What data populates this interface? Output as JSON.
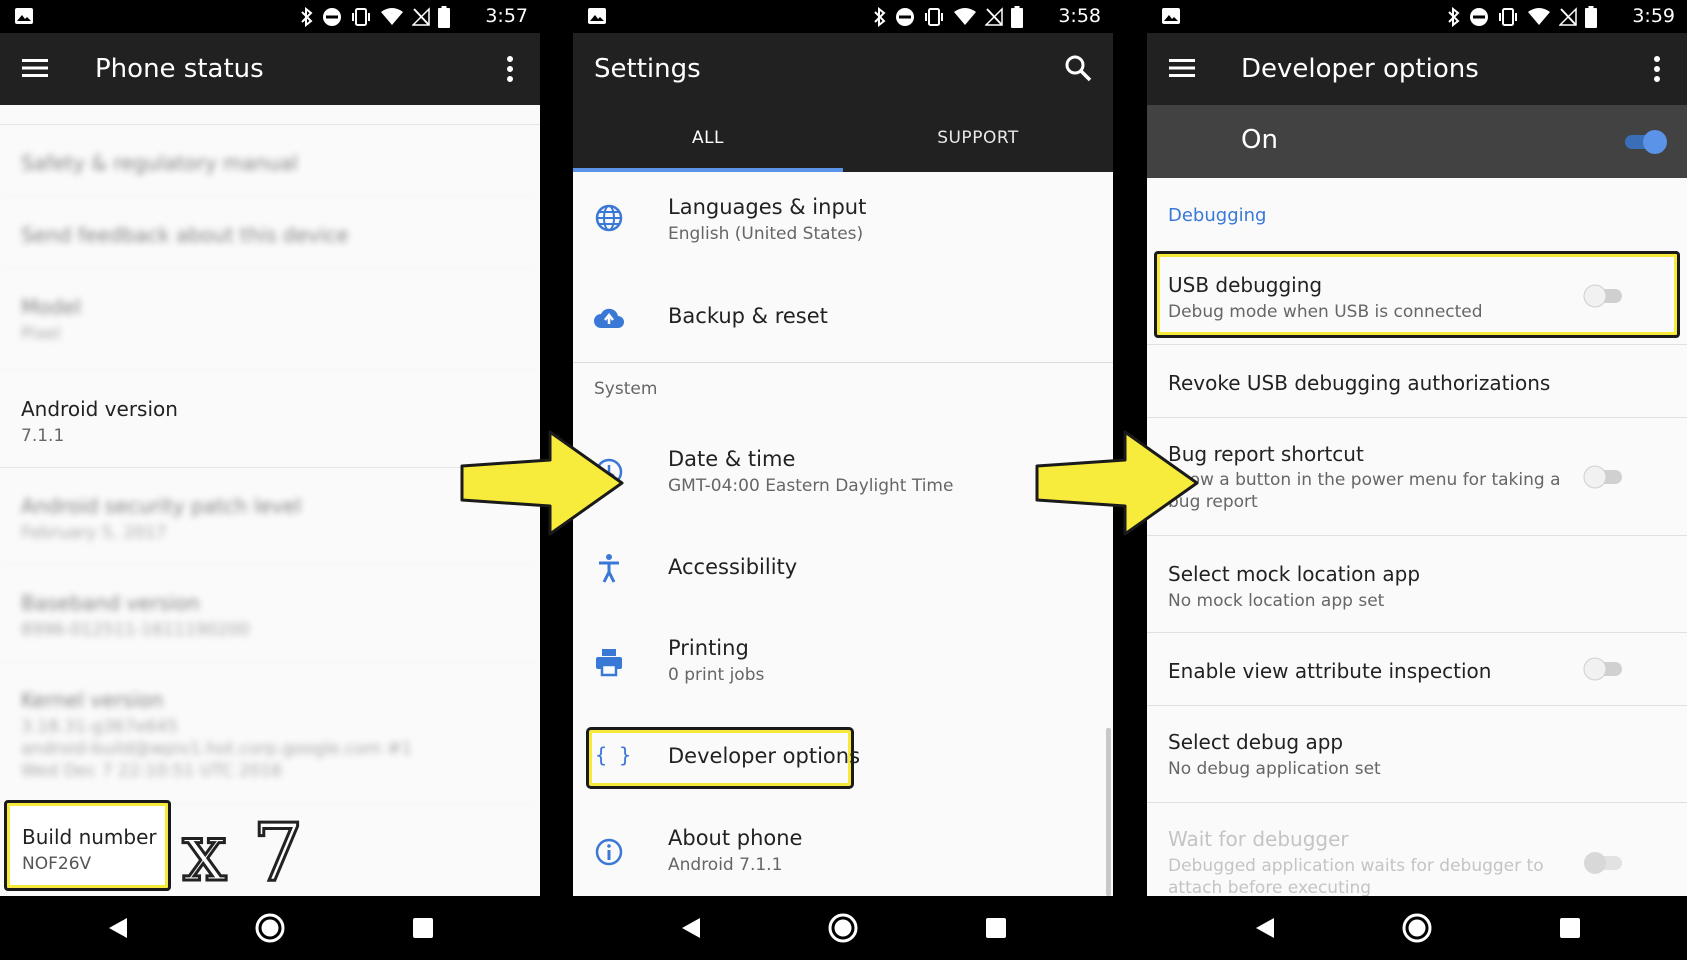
{
  "colors": {
    "highlight": "#f7e93a",
    "accent": "#3a78d6",
    "appbar": "#212121",
    "toggle_on": "#5b93e8"
  },
  "panel1": {
    "status_time": "3:57",
    "title": "Phone status",
    "rows": {
      "safety": "Safety & regulatory manual",
      "feedback": "Send feedback about this device",
      "model_title": "Model",
      "model_sub": "Pixel",
      "android_title": "Android version",
      "android_sub": "7.1.1",
      "security_title": "Android security patch level",
      "security_sub": "February 5, 2017",
      "baseband_title": "Baseband version",
      "baseband_sub": "8996-012511-1611190200",
      "kernel_title": "Kernel version",
      "kernel_l1": "3.18.31-g367e645",
      "kernel_l2": "android-build@wpiv1.hot.corp.google.com #1",
      "kernel_l3": "Wed Dec 7 22:10:51 UTC 2016",
      "build_title": "Build number",
      "build_sub": "NOF26V"
    },
    "tap_count": "x 7"
  },
  "panel2": {
    "status_time": "3:58",
    "title": "Settings",
    "tabs": {
      "all": "ALL",
      "support": "SUPPORT"
    },
    "items": {
      "languages_title": "Languages & input",
      "languages_sub": "English (United States)",
      "backup_title": "Backup & reset",
      "system_header": "System",
      "date_title": "Date & time",
      "date_sub": "GMT-04:00 Eastern Daylight Time",
      "access_title": "Accessibility",
      "printing_title": "Printing",
      "printing_sub": "0 print jobs",
      "dev_title": "Developer options",
      "about_title": "About phone",
      "about_sub": "Android 7.1.1"
    }
  },
  "panel3": {
    "status_time": "3:59",
    "title": "Developer options",
    "master_label": "On",
    "section": "Debugging",
    "rows": {
      "usb_title": "USB debugging",
      "usb_sub": "Debug mode when USB is connected",
      "revoke_title": "Revoke USB debugging authorizations",
      "bug_title": "Bug report shortcut",
      "bug_sub": "Show a button in the power menu for taking a bug report",
      "mock_title": "Select mock location app",
      "mock_sub": "No mock location app set",
      "viewattr_title": "Enable view attribute inspection",
      "debugapp_title": "Select debug app",
      "debugapp_sub": "No debug application set",
      "wait_title": "Wait for debugger",
      "wait_sub": "Debugged application waits for debugger to attach before executing"
    }
  }
}
